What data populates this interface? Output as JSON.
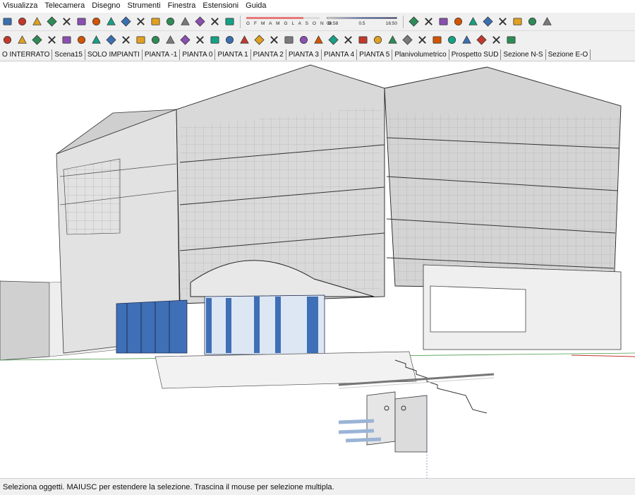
{
  "menu": [
    "Visualizza",
    "Telecamera",
    "Disegno",
    "Strumenti",
    "Finestra",
    "Estensioni",
    "Guida"
  ],
  "toolbar1": {
    "icons_a": [
      "cut-icon",
      "copy-icon",
      "paste-icon",
      "erase-icon",
      "undo-icon",
      "redo-icon",
      "print-icon",
      "model-info-icon",
      "xray-icon",
      "back-edges-icon",
      "wireframe-icon",
      "hidden-line-icon",
      "shaded-icon",
      "shaded-textures-icon",
      "monochrome-icon",
      "shadows-toggle-icon"
    ],
    "shadow_months": "G F M A M G L A S O N D",
    "shadow_month_level": 0.78,
    "time_start": "06:58",
    "time_mid": "0.5",
    "time_end": "16:50",
    "icons_b": [
      "fog-icon",
      "styles-icon",
      "section-icon",
      "axis-icon",
      "dimension-icon",
      "flag-icon",
      "guide-icon",
      "protractor-icon",
      "arrow-icon",
      "gradient-cube-icon"
    ]
  },
  "toolbar2": {
    "icons": [
      "eraser-icon",
      "pencil-icon",
      "freehand-icon",
      "rectangle-icon",
      "rotated-rectangle-icon",
      "circle-icon",
      "polygon-icon",
      "arc-icon",
      "two-point-arc-icon",
      "pie-icon",
      "push-pull-icon",
      "layer-0-icon",
      "layer-1-icon",
      "layer-2-icon",
      "layer-3-icon",
      "layer-4-icon",
      "layer-5-icon",
      "layer-6-icon",
      "layer-7-icon",
      "layer-8-icon",
      "layer-9-icon",
      "layer-10-icon",
      "paint-bucket-icon",
      "tape-measure-icon",
      "follow-me-icon",
      "text-icon",
      "axes-icon",
      "walk-icon",
      "move-icon",
      "rotate-icon",
      "scale-icon",
      "offset-icon",
      "tag-icon",
      "orbit-icon",
      "pan-icon"
    ]
  },
  "scenes": [
    "O INTERRATO",
    "Scena15",
    "SOLO IMPIANTI",
    "PIANTA -1",
    "PIANTA 0",
    "PIANTA 1",
    "PIANTA 2",
    "PIANTA 3",
    "PIANTA 4",
    "PIANTA 5",
    "Planivolumetrico",
    "Prospetto SUD",
    "Sezione N-S",
    "Sezione E-O"
  ],
  "status": "Seleziona oggetti. MAIUSC per estendere la selezione. Trascina il mouse per selezione multipla.",
  "colors": {
    "glass": "#3f6fb6",
    "wall": "#bcbcbc",
    "line": "#2a2a2a",
    "ground": "#4a9a4a",
    "accent_red": "#c0392b",
    "slider_red": "#e57a7a"
  }
}
